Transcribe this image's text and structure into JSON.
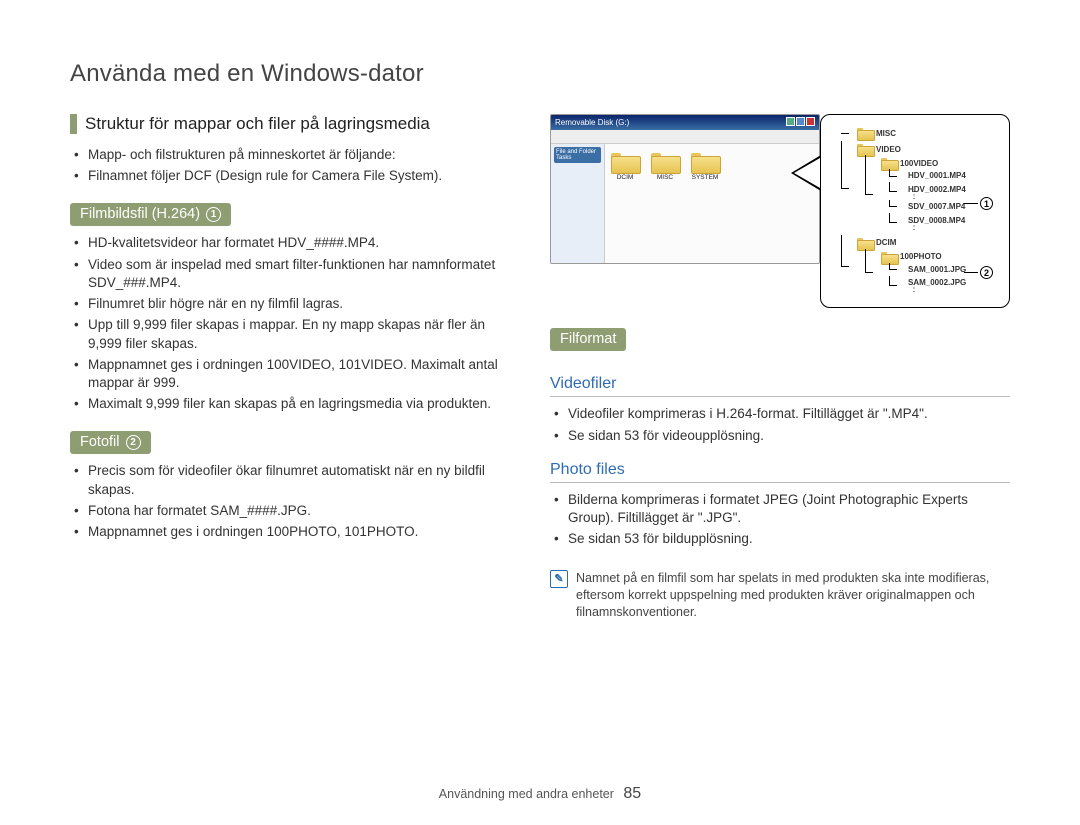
{
  "page_title": "Använda med en Windows-dator",
  "footer": {
    "section": "Användning med andra enheter",
    "page": "85"
  },
  "left": {
    "heading": "Struktur för mappar och filer på lagringsmedia",
    "intro": [
      "Mapp- och filstrukturen på minneskortet är följande:",
      "Filnamnet följer DCF (Design rule for Camera File System)."
    ],
    "film": {
      "badge": "Filmbildsfil (H.264)",
      "num": "1",
      "items": [
        "HD-kvalitetsvideor har formatet HDV_####.MP4.",
        "Video som är inspelad med smart filter-funktionen har namnformatet SDV_###.MP4.",
        "Filnumret blir högre när en ny filmfil lagras.",
        "Upp till 9,999 filer skapas i mappar. En ny mapp skapas när fler än 9,999 filer skapas.",
        "Mappnamnet ges i ordningen 100VIDEO, 101VIDEO. Maximalt antal mappar är 999.",
        "Maximalt 9,999 filer kan skapas på en lagringsmedia via produkten."
      ]
    },
    "foto": {
      "badge": "Fotofil",
      "num": "2",
      "items": [
        "Precis som för videofiler ökar filnumret automatiskt när en ny bildfil skapas.",
        "Fotona har formatet SAM_####.JPG.",
        "Mappnamnet ges i ordningen 100PHOTO, 101PHOTO."
      ]
    }
  },
  "right": {
    "thumb": {
      "window_title": "Removable Disk (G:)",
      "sidebar": "File and Folder Tasks",
      "folders": [
        "DCIM",
        "MISC",
        "SYSTEM"
      ]
    },
    "tree": {
      "labels": {
        "misc": "MISC",
        "video": "VIDEO",
        "video100": "100VIDEO",
        "v1": "HDV_0001.MP4",
        "v2": "HDV_0002.MP4",
        "v3": "SDV_0007.MP4",
        "v4": "SDV_0008.MP4",
        "dcim": "DCIM",
        "photo100": "100PHOTO",
        "p1": "SAM_0001.JPG",
        "p2": "SAM_0002.JPG"
      }
    },
    "filformat": {
      "badge": "Filformat",
      "video_sub": "Videofiler",
      "video_items": [
        "Videofiler komprimeras i H.264-format. Filtillägget är \".MP4\".",
        "Se sidan 53 för videoupplösning."
      ],
      "photo_sub": "Photo files",
      "photo_items": [
        "Bilderna komprimeras i formatet JPEG (Joint Photographic Experts Group). Filtillägget är \".JPG\".",
        "Se sidan 53 för bildupplösning."
      ]
    },
    "note": "Namnet på en filmfil som har spelats in med produkten ska inte modifieras, eftersom korrekt uppspelning med produkten kräver originalmappen och filnamnskonventioner."
  }
}
